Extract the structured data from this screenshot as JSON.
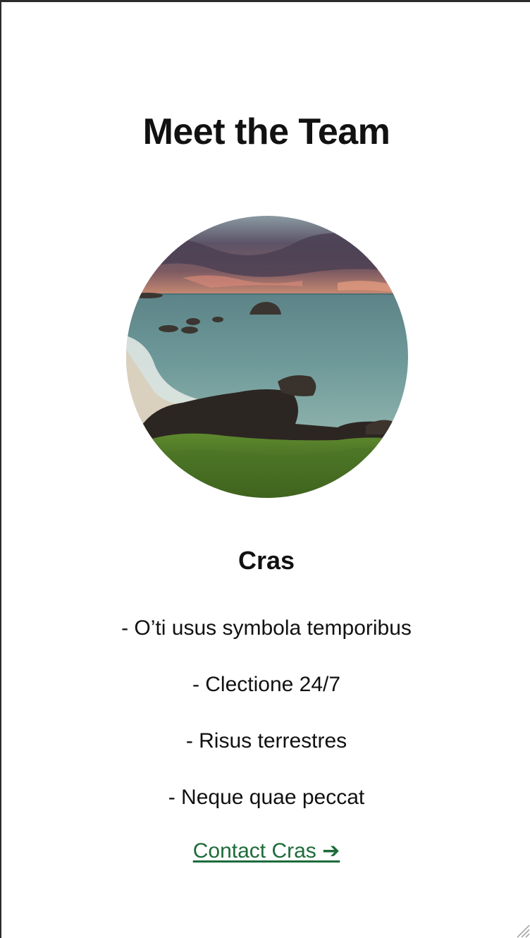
{
  "page": {
    "title": "Meet the Team"
  },
  "member": {
    "name": "Cras",
    "bullets": [
      "- O’ti usus symbola temporibus",
      "- Clectione 24/7",
      "- Risus terrestres",
      "- Neque quae peccat"
    ],
    "contact_label": "Contact Cras ➔"
  },
  "colors": {
    "link": "#1d6b3a",
    "text": "#111111",
    "background": "#ffffff"
  },
  "icons": {
    "arrow": "right-arrow-icon",
    "grip": "resize-grip-icon"
  }
}
